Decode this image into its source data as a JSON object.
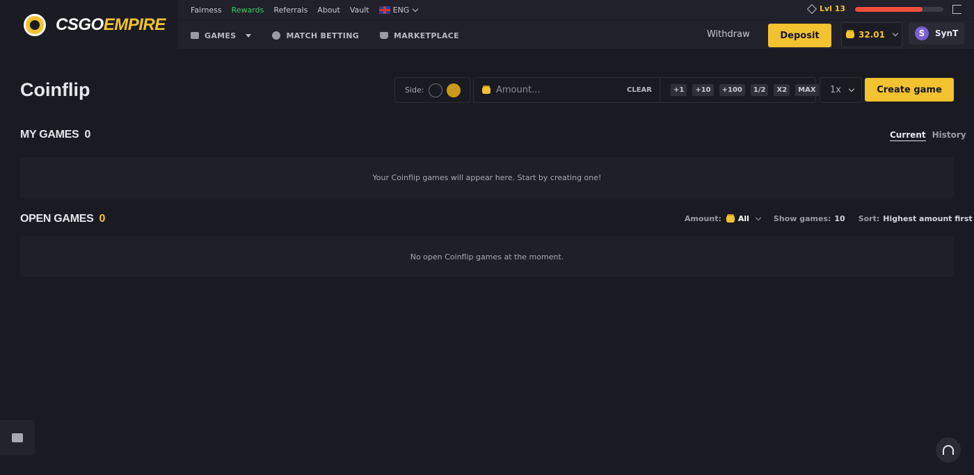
{
  "brand": {
    "name_white": "CSGO",
    "name_gold": "EMPIRE"
  },
  "topnav": [
    "Fairness",
    "Rewards",
    "Referrals",
    "About",
    "Vault"
  ],
  "language": "ENG",
  "mainnav": {
    "games": "GAMES",
    "match_betting": "MATCH BETTING",
    "marketplace": "MARKETPLACE"
  },
  "account": {
    "level": "Lvl 13",
    "xp_progress": 0.76,
    "withdraw": "Withdraw",
    "deposit": "Deposit",
    "balance": "32.01",
    "avatar_initial": "S",
    "username": "SynT"
  },
  "page": {
    "title": "Coinflip",
    "side_label": "Side:",
    "amount_placeholder": "Amount...",
    "clear": "CLEAR",
    "quick": [
      "+1",
      "+10",
      "+100",
      "1/2",
      "X2",
      "MAX"
    ],
    "multiplier": "1x",
    "create": "Create game"
  },
  "my_games": {
    "title": "MY GAMES",
    "count": "0",
    "tab_current": "Current",
    "tab_history": "History",
    "empty": "Your Coinflip games will appear here. Start by creating one!"
  },
  "open_games": {
    "title": "OPEN GAMES",
    "count": "0",
    "amount_label": "Amount:",
    "amount_value": "All",
    "show_label": "Show games:",
    "show_value": "10",
    "sort_label": "Sort:",
    "sort_value": "Highest amount first",
    "empty": "No open Coinflip games at the moment."
  },
  "colors": {
    "accent": "#f2c230",
    "active_link": "#3ecf63",
    "xp": "#ee4f3c"
  }
}
